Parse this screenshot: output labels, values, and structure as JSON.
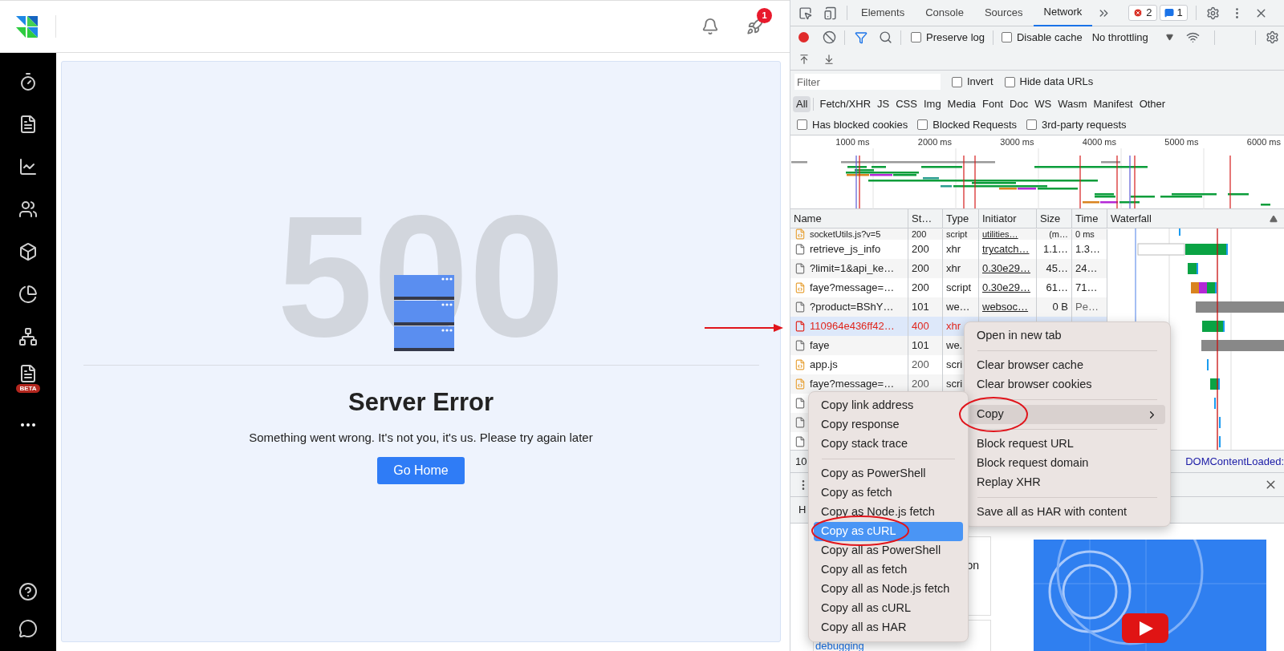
{
  "app": {
    "header": {
      "notification_badge": "1"
    },
    "sidebar": {
      "beta_badge": "BETA"
    }
  },
  "error_page": {
    "code": "500",
    "title": "Server Error",
    "message": "Something went wrong. It's not you, it's us. Please try again later",
    "button": "Go Home"
  },
  "devtools": {
    "tabs": [
      {
        "label": "Elements",
        "selected": false
      },
      {
        "label": "Console",
        "selected": false
      },
      {
        "label": "Sources",
        "selected": false
      },
      {
        "label": "Network",
        "selected": true
      }
    ],
    "error_count": "2",
    "message_count": "1",
    "toolbar": {
      "recording": true,
      "preserve_log": {
        "label": "Preserve log",
        "checked": false
      },
      "disable_cache": {
        "label": "Disable cache",
        "checked": false
      },
      "throttling": "No throttling"
    },
    "filter": {
      "placeholder": "Filter",
      "options": [
        {
          "label": "Invert",
          "checked": false
        },
        {
          "label": "Hide data URLs",
          "checked": false
        }
      ]
    },
    "type_filters": [
      {
        "label": "All",
        "selected": true
      },
      {
        "label": "Fetch/XHR",
        "selected": false
      },
      {
        "label": "JS",
        "selected": false
      },
      {
        "label": "CSS",
        "selected": false
      },
      {
        "label": "Img",
        "selected": false
      },
      {
        "label": "Media",
        "selected": false
      },
      {
        "label": "Font",
        "selected": false
      },
      {
        "label": "Doc",
        "selected": false
      },
      {
        "label": "WS",
        "selected": false
      },
      {
        "label": "Wasm",
        "selected": false
      },
      {
        "label": "Manifest",
        "selected": false
      },
      {
        "label": "Other",
        "selected": false
      }
    ],
    "request_filters": [
      {
        "label": "Has blocked cookies",
        "checked": false
      },
      {
        "label": "Blocked Requests",
        "checked": false
      },
      {
        "label": "3rd-party requests",
        "checked": false
      }
    ],
    "timeline": {
      "ticks": [
        "1000 ms",
        "2000 ms",
        "3000 ms",
        "4000 ms",
        "5000 ms",
        "6000 ms"
      ]
    },
    "table": {
      "columns": [
        "Name",
        "St…",
        "Type",
        "Initiator",
        "Size",
        "Time",
        "Waterfall"
      ],
      "rows": [
        {
          "kind": "script",
          "name": "socketUtils.js?v=5",
          "status": "200",
          "type": "script",
          "initiator": "utilities…",
          "size": "(m…",
          "time": "0 ms",
          "error": false,
          "selected": false
        },
        {
          "kind": "document",
          "name": "retrieve_js_info",
          "status": "200",
          "type": "xhr",
          "initiator": "trycatch…",
          "size": "1.1…",
          "time": "1.3…",
          "error": false,
          "selected": false
        },
        {
          "kind": "document",
          "name": "?limit=1&api_ke…",
          "status": "200",
          "type": "xhr",
          "initiator": "0.30e29…",
          "size": "45…",
          "time": "24…",
          "error": false,
          "selected": false
        },
        {
          "kind": "script",
          "name": "faye?message=…",
          "status": "200",
          "type": "script",
          "initiator": "0.30e29…",
          "size": "61…",
          "time": "71…",
          "error": false,
          "selected": false
        },
        {
          "kind": "document",
          "name": "?product=BShY…",
          "status": "101",
          "type": "we…",
          "initiator": "websoc…",
          "size": "0 B",
          "time": "Pe…",
          "error": false,
          "selected": false
        },
        {
          "kind": "document",
          "name": "110964e436ff42…",
          "status": "400",
          "type": "xhr",
          "error": true,
          "selected": true
        },
        {
          "kind": "document",
          "name": "faye",
          "status": "101",
          "type": "we.",
          "error": false,
          "selected": false
        },
        {
          "kind": "script",
          "name": "app.js",
          "status": "200",
          "type": "scri",
          "error": false,
          "selected": false
        },
        {
          "kind": "script",
          "name": "faye?message=…",
          "status": "200",
          "type": "scri",
          "error": false,
          "selected": false
        },
        {
          "kind": "document",
          "error": false,
          "selected": false
        },
        {
          "kind": "document",
          "error": false,
          "selected": false
        },
        {
          "kind": "document",
          "error": false,
          "selected": false
        }
      ]
    },
    "status_bar": {
      "requests": "10",
      "dom_content_loaded": "DOMContentLoaded:"
    },
    "drawer": {
      "tab": "H",
      "card_text": "on",
      "link": "debugging"
    },
    "context_menu": {
      "groups": [
        [
          {
            "label": "Open in new tab",
            "selected": false,
            "submenu": false
          }
        ],
        [
          {
            "label": "Clear browser cache",
            "selected": false,
            "submenu": false
          },
          {
            "label": "Clear browser cookies",
            "selected": false,
            "submenu": false
          }
        ],
        [
          {
            "label": "Copy",
            "selected": true,
            "submenu": true
          }
        ],
        [
          {
            "label": "Block request URL",
            "selected": false,
            "submenu": false
          },
          {
            "label": "Block request domain",
            "selected": false,
            "submenu": false
          },
          {
            "label": "Replay XHR",
            "selected": false,
            "submenu": false
          }
        ],
        [
          {
            "label": "Save all as HAR with content",
            "selected": false,
            "submenu": false
          }
        ]
      ]
    },
    "copy_submenu": {
      "groups": [
        [
          {
            "label": "Copy link address",
            "selected": false
          },
          {
            "label": "Copy response",
            "selected": false
          },
          {
            "label": "Copy stack trace",
            "selected": false
          }
        ],
        [
          {
            "label": "Copy as PowerShell",
            "selected": false
          },
          {
            "label": "Copy as fetch",
            "selected": false
          },
          {
            "label": "Copy as Node.js fetch",
            "selected": false
          },
          {
            "label": "Copy as cURL",
            "selected": true
          },
          {
            "label": "Copy all as PowerShell",
            "selected": false
          },
          {
            "label": "Copy all as fetch",
            "selected": false
          },
          {
            "label": "Copy all as Node.js fetch",
            "selected": false
          },
          {
            "label": "Copy all as cURL",
            "selected": false
          },
          {
            "label": "Copy all as HAR",
            "selected": false
          }
        ]
      ]
    }
  }
}
